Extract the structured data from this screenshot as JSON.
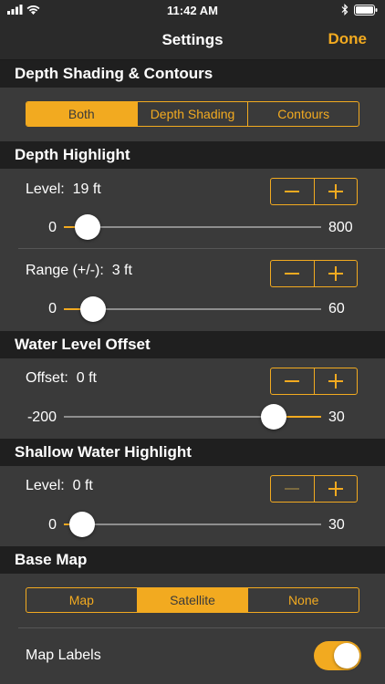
{
  "status": {
    "time": "11:42 AM"
  },
  "nav": {
    "title": "Settings",
    "done": "Done"
  },
  "colors": {
    "accent": "#f2aa20",
    "background": "#3a3a3a",
    "header": "#1f1f1f"
  },
  "depth_shading": {
    "header": "Depth Shading & Contours",
    "options": [
      "Both",
      "Depth Shading",
      "Contours"
    ],
    "selected": "Both"
  },
  "depth_highlight": {
    "header": "Depth Highlight",
    "level": {
      "label": "Level:",
      "value": "19 ft",
      "min": "0",
      "max": "800",
      "fraction": 0.024
    },
    "range": {
      "label": "Range (+/-):",
      "value": "3 ft",
      "min": "0",
      "max": "60",
      "fraction": 0.05
    }
  },
  "water_level": {
    "header": "Water Level Offset",
    "offset": {
      "label": "Offset:",
      "value": "0 ft",
      "min": "-200",
      "max": "30",
      "fraction": 0.8696
    }
  },
  "shallow_water": {
    "header": "Shallow Water Highlight",
    "level": {
      "label": "Level:",
      "value": "0 ft",
      "min": "0",
      "max": "30",
      "fraction": 0.0,
      "decrement_enabled": false
    }
  },
  "base_map": {
    "header": "Base Map",
    "options": [
      "Map",
      "Satellite",
      "None"
    ],
    "selected": "Satellite",
    "labels_row": {
      "label": "Map Labels",
      "enabled": true
    }
  }
}
